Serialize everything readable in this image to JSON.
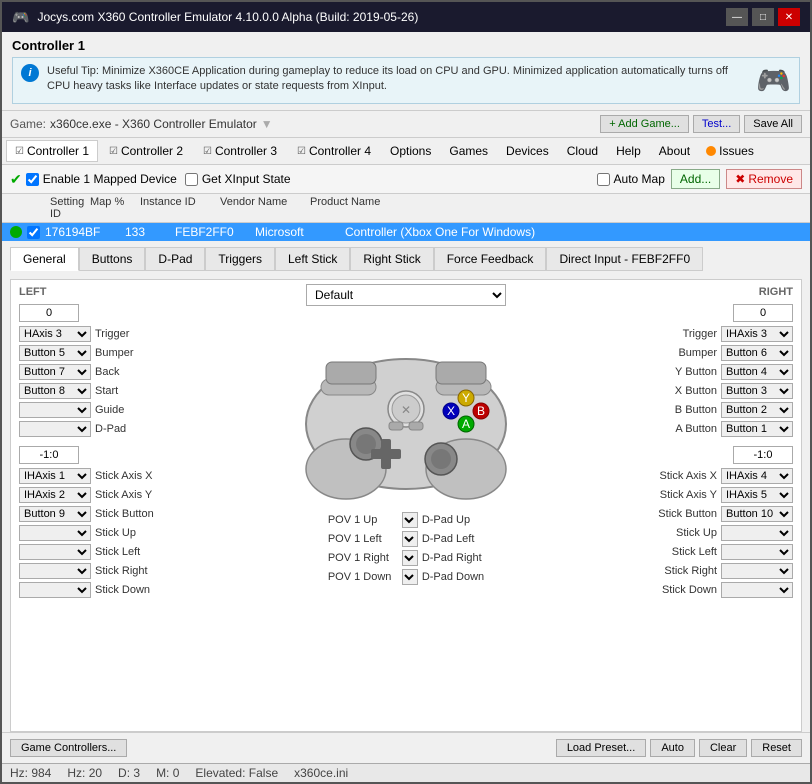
{
  "titlebar": {
    "title": "Jocys.com X360 Controller Emulator 4.10.0.0 Alpha (Build: 2019-05-26)",
    "min_btn": "—",
    "max_btn": "□",
    "close_btn": "✕"
  },
  "controller_section": {
    "title": "Controller 1",
    "tip_text": "Useful Tip: Minimize X360CE Application during gameplay to reduce its load on CPU and GPU. Minimized application automatically turns off CPU heavy tasks like Interface updates or state requests from XInput.",
    "tip_icon": "i"
  },
  "game_bar": {
    "label": "Game:",
    "game_exe": "x360ce.exe - X360 Controller Emulator",
    "add_game_btn": "+ Add Game...",
    "test_btn": "Test...",
    "save_all_btn": "Save All"
  },
  "menu": {
    "items": [
      "Controller 1",
      "Controller 2",
      "Controller 3",
      "Controller 4",
      "Options",
      "Games",
      "Devices",
      "Cloud",
      "Help",
      "About",
      "Issues"
    ]
  },
  "toolbar": {
    "enable_mapped": "Enable 1 Mapped Device",
    "get_xinput": "Get XInput State",
    "auto_map": "Auto Map",
    "add_btn": "Add...",
    "remove_btn": "Remove"
  },
  "table": {
    "headers": [
      "Setting ID",
      "Map %",
      "Instance ID",
      "Vendor Name",
      "Product Name"
    ],
    "row": {
      "setting_id": "176194BF",
      "map_pct": "133",
      "instance_id": "FEBF2FF0",
      "vendor": "Microsoft",
      "product": "Controller (Xbox One For Windows)"
    }
  },
  "tabs": {
    "items": [
      "General",
      "Buttons",
      "D-Pad",
      "Triggers",
      "Left Stick",
      "Right Stick",
      "Force Feedback",
      "Direct Input - FEBF2FF0"
    ]
  },
  "left_panel": {
    "label": "LEFT",
    "value_box": "0",
    "controls": [
      {
        "select": "HAxis 3",
        "label": "Trigger"
      },
      {
        "select": "Button 5",
        "label": "Bumper"
      },
      {
        "select": "Button 7",
        "label": "Back"
      },
      {
        "select": "Button 8",
        "label": "Start"
      },
      {
        "select": "",
        "label": "Guide"
      },
      {
        "select": "",
        "label": "D-Pad"
      }
    ],
    "stick_value": "-1:0",
    "stick_controls": [
      {
        "select": "IHAxis 1",
        "label": "Stick Axis X"
      },
      {
        "select": "IHAxis 2",
        "label": "Stick Axis Y"
      },
      {
        "select": "Button 9",
        "label": "Stick Button"
      },
      {
        "select": "",
        "label": "Stick Up"
      },
      {
        "select": "",
        "label": "Stick Left"
      },
      {
        "select": "",
        "label": "Stick Right"
      },
      {
        "select": "",
        "label": "Stick Down"
      }
    ]
  },
  "right_panel": {
    "label": "RIGHT",
    "value_box": "0",
    "controls": [
      {
        "label": "Trigger",
        "select": "IHAxis 3"
      },
      {
        "label": "Bumper",
        "select": "Button 6"
      },
      {
        "label": "Y Button",
        "select": "Button 4"
      },
      {
        "label": "X Button",
        "select": "Button 3"
      },
      {
        "label": "B Button",
        "select": "Button 2"
      },
      {
        "label": "A Button",
        "select": "Button 1"
      }
    ],
    "stick_value": "-1:0",
    "stick_controls": [
      {
        "label": "Stick Axis X",
        "select": "IHAxis 4"
      },
      {
        "label": "Stick Axis Y",
        "select": "IHAxis 5"
      },
      {
        "label": "Stick Button",
        "select": "Button 10"
      },
      {
        "label": "Stick Up",
        "select": ""
      },
      {
        "label": "Stick Left",
        "select": ""
      },
      {
        "label": "Stick Right",
        "select": ""
      },
      {
        "label": "Stick Down",
        "select": ""
      }
    ]
  },
  "center": {
    "default_select": "Default",
    "pov_rows": [
      {
        "label": "POV 1 Up",
        "value": "D-Pad Up"
      },
      {
        "label": "POV 1 Left",
        "value": "D-Pad Left"
      },
      {
        "label": "POV 1 Right",
        "value": "D-Pad Right"
      },
      {
        "label": "POV 1 Down",
        "value": "D-Pad Down"
      }
    ]
  },
  "bottom_buttons": {
    "game_controllers": "Game Controllers...",
    "load_preset": "Load Preset...",
    "auto": "Auto",
    "clear": "Clear",
    "reset": "Reset"
  },
  "status_bar": {
    "hz": "Hz: 984",
    "fps": "Hz: 20",
    "d": "D: 3",
    "m": "M: 0",
    "elevated": "Elevated: False",
    "ini": "x360ce.ini"
  }
}
